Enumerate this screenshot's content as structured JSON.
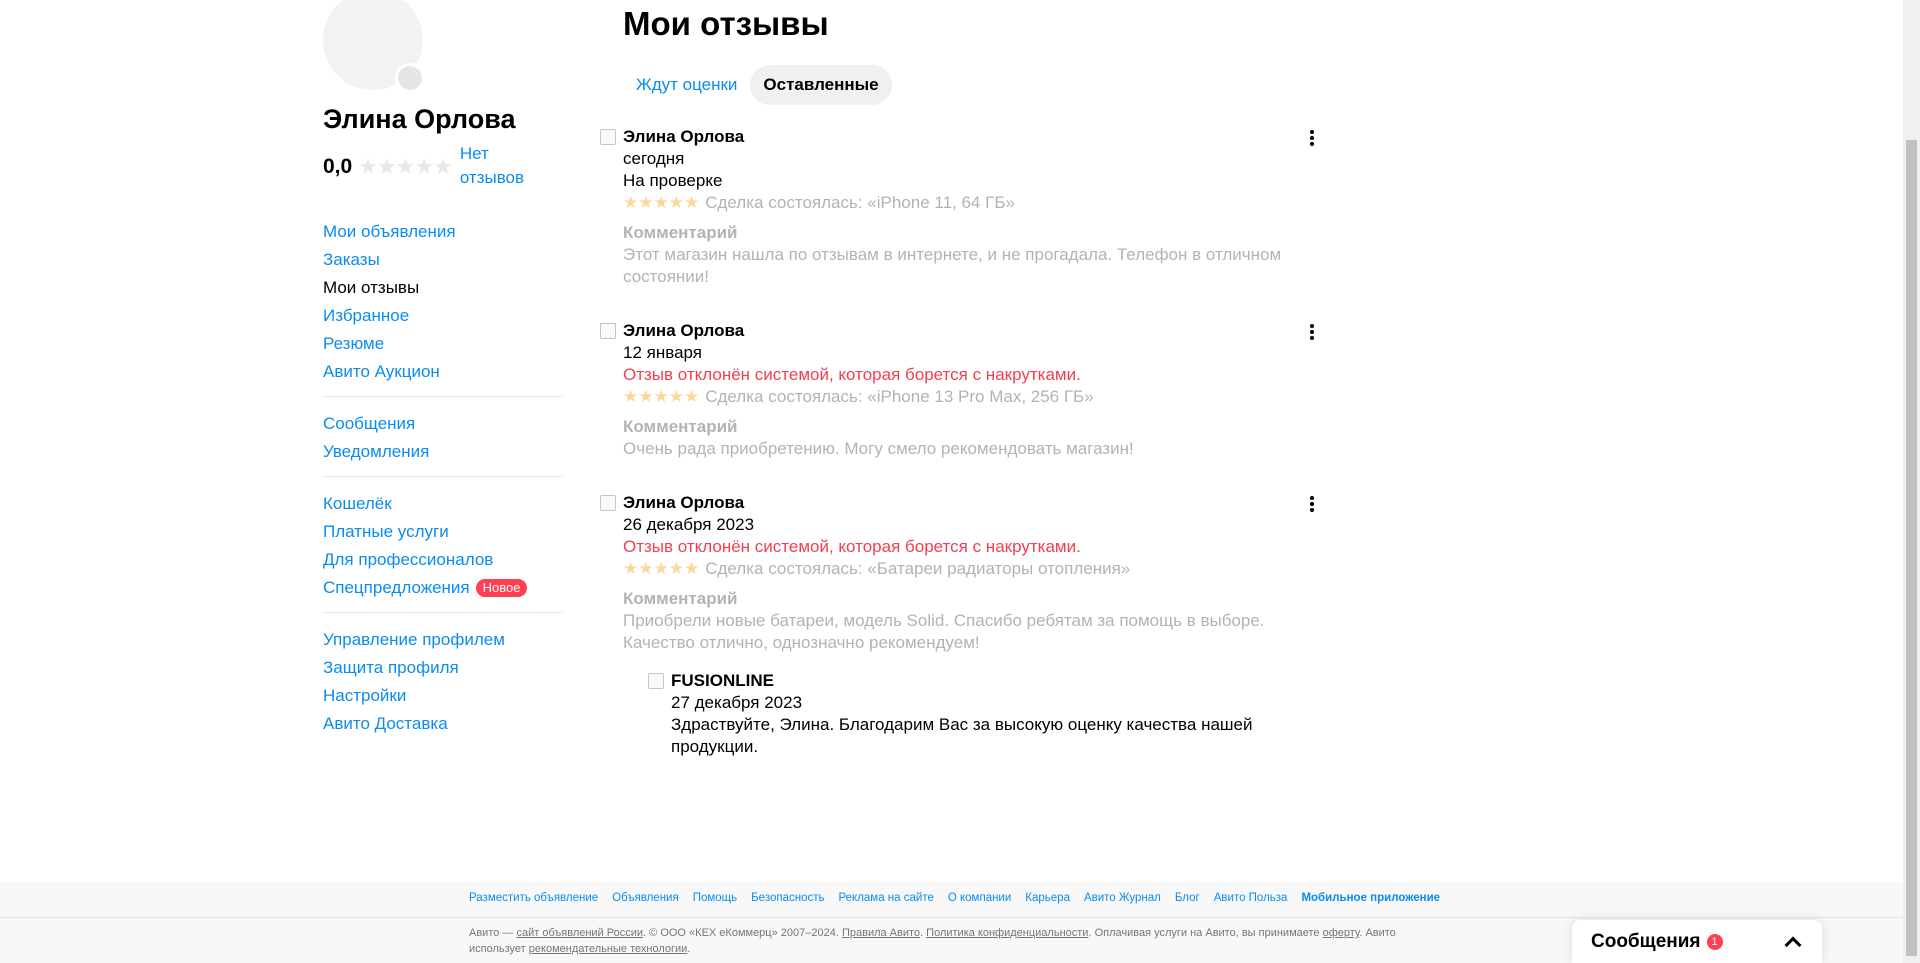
{
  "profile": {
    "name": "Элина Орлова",
    "rating": "0,0",
    "stars": "★★★★★",
    "no_reviews": "Нет отзывов"
  },
  "nav": {
    "groups": [
      [
        "Мои объявления",
        "Заказы",
        "Мои отзывы",
        "Избранное",
        "Резюме",
        "Авито Аукцион"
      ],
      [
        "Сообщения",
        "Уведомления"
      ],
      [
        "Кошелёк",
        "Платные услуги",
        "Для профессионалов",
        "Спецпредложения"
      ],
      [
        "Управление профилем",
        "Защита профиля",
        "Настройки",
        "Авито Доставка"
      ]
    ],
    "badge_new": "Новое"
  },
  "main": {
    "title": "Мои отзывы",
    "tabs": [
      "Ждут оценки",
      "Оставленные"
    ]
  },
  "reviews": [
    {
      "author": "Элина Орлова",
      "date": "сегодня",
      "status": "На проверке",
      "stars": "★★★★★",
      "deal": "Сделка состоялась: «iPhone 11, 64 ГБ»",
      "comment_title": "Комментарий",
      "comment": "Этот магазин нашла по отзывам в интернете, и не прогадала. Телефон в отличном состоянии!"
    },
    {
      "author": "Элина Орлова",
      "date": "12 января",
      "status": "Отзыв отклонён системой, которая борется с накрутками.",
      "stars": "★★★★★",
      "deal": "Сделка состоялась: «iPhone 13 Pro Max, 256 ГБ»",
      "comment_title": "Комментарий",
      "comment": "Очень рада приобретению. Могу смело рекомендовать магазин!"
    },
    {
      "author": "Элина Орлова",
      "date": "26 декабря 2023",
      "status": "Отзыв отклонён системой, которая борется с накрутками.",
      "stars": "★★★★★",
      "deal": "Сделка состоялась: «Батареи радиаторы отопления»",
      "comment_title": "Комментарий",
      "comment": "Приобрели новые батареи, модель Solid. Спасибо ребятам за помощь в выборе. Качество отлично, однозначно рекомендуем!"
    }
  ],
  "reply": {
    "author": "FUSIONLINE",
    "date": "27 декабря 2023",
    "text": "Здраствуйте, Элина. Благодарим Вас за высокую оценку качества нашей продукции."
  },
  "footer": {
    "links": [
      "Разместить объявление",
      "Объявления",
      "Помощь",
      "Безопасность",
      "Реклама на сайте",
      "О компании",
      "Карьера",
      "Авито Журнал",
      "Блог",
      "Авито Польза",
      "Мобильное приложение"
    ],
    "legal": {
      "p1": "Авито — ",
      "l1": "сайт объявлений России",
      "p2": ". © ООО «КЕХ еКоммерц» 2007–2024. ",
      "l2": "Правила Авито",
      "p3": ". ",
      "l3": "Политика конфиденциальности",
      "p4": ". Оплачивая услуги на Авито, вы принимаете ",
      "l4": "оферту",
      "p5": ". Авито использует ",
      "l5": "рекомендательные технологии",
      "p6": "."
    }
  },
  "messages_widget": {
    "label": "Сообщения",
    "count": "1"
  },
  "colors": {
    "link": "#0a8cf0",
    "danger": "#f04050",
    "muted": "#b3b3b3",
    "star_inactive": "#e8e8e8",
    "star_review": "#ffd699"
  }
}
